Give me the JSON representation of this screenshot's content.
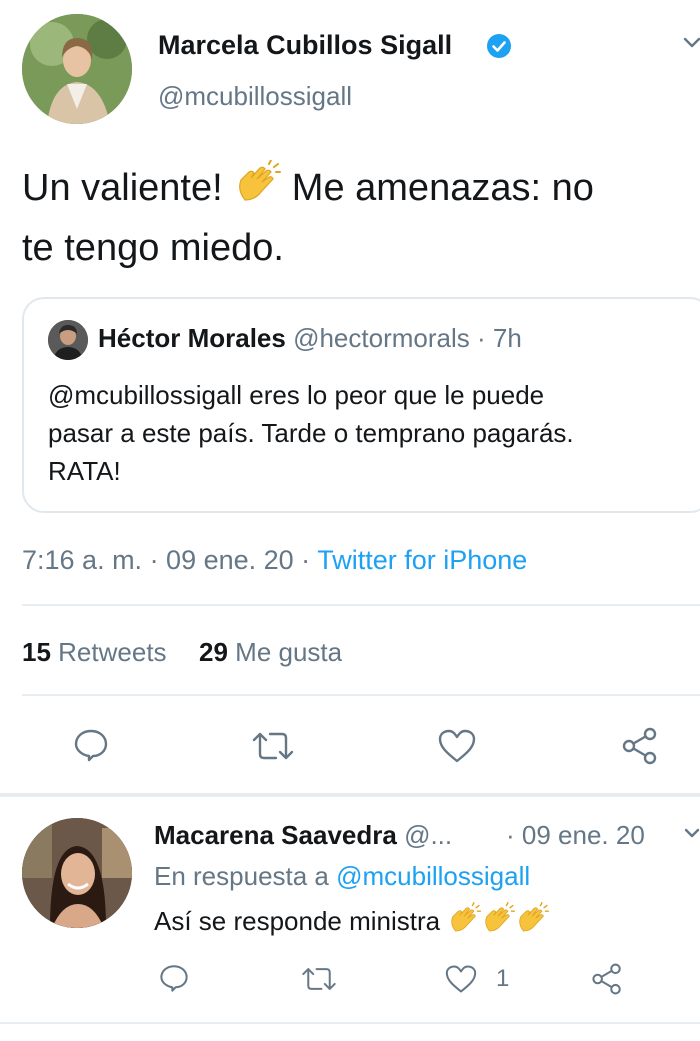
{
  "tweet": {
    "author_name": "Marcela Cubillos Sigall",
    "author_handle": "@mcubillossigall",
    "text_part1": "Un valiente!",
    "text_part2": "Me amenazas: no",
    "text_part3": "te tengo miedo.",
    "timestamp": "7:16 a. m. · 09 ene. 20 · ",
    "source": "Twitter for iPhone",
    "retweets_count": "15",
    "retweets_label": "Retweets",
    "likes_count": "29",
    "likes_label": "Me gusta"
  },
  "quoted": {
    "author_name": "Héctor Morales",
    "author_handle": "@hectormorals",
    "time": " · 7h",
    "line1": "@mcubillossigall eres lo peor que le puede",
    "line2": "pasar a este país. Tarde o temprano pagarás.",
    "line3": "RATA!"
  },
  "reply": {
    "author_name": "Macarena Saavedra",
    "author_handle": "@...",
    "date": "· 09 ene. 20",
    "reply_to_label": "En respuesta a",
    "reply_to_handle": "@mcubillossigall",
    "text": "Así se responde ministra",
    "like_count": "1"
  },
  "icons": {
    "verified": "verified-badge-icon",
    "reply": "reply-icon",
    "retweet": "retweet-icon",
    "like": "heart-icon",
    "share": "share-icon",
    "menu": "chevron-down-icon",
    "emoji": "clapping-hands-emoji"
  },
  "colors": {
    "accent": "#1da1f2",
    "secondary_text": "#657786",
    "divider": "#e6ecf0"
  }
}
